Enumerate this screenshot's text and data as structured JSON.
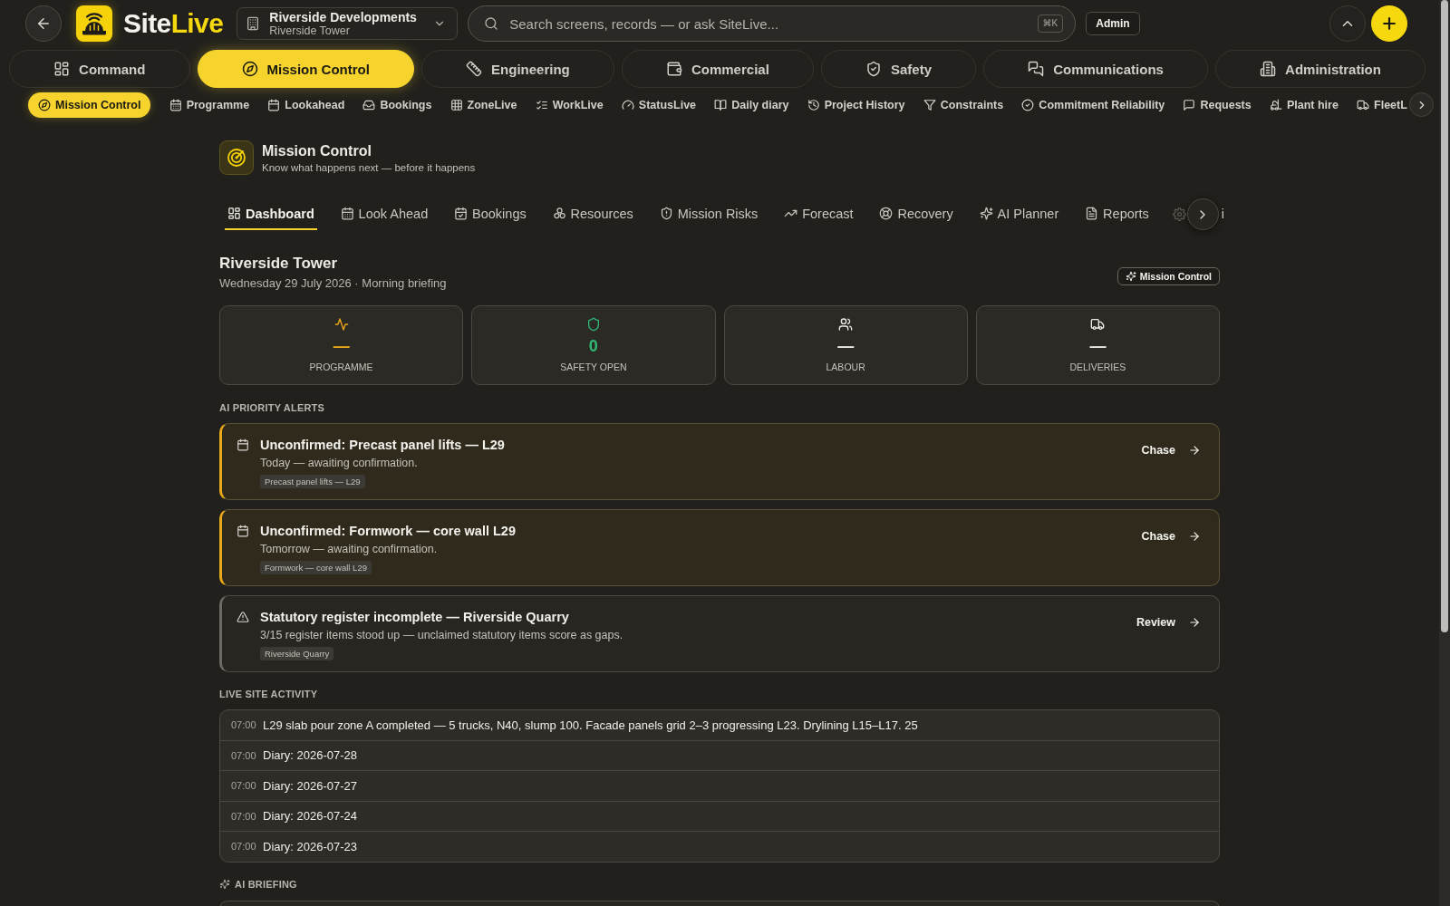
{
  "top_bar": {
    "brand": {
      "name_start": "Site",
      "name_end": "Live"
    },
    "project_selector": {
      "company": "Riverside Developments",
      "project": "Riverside Tower"
    },
    "search": {
      "placeholder": "Search screens, records — or ask SiteLive...",
      "shortcut": "⌘K"
    },
    "role": "Admin"
  },
  "module_tabs": [
    {
      "label": "Command",
      "selected": false
    },
    {
      "label": "Mission Control",
      "selected": true
    },
    {
      "label": "Engineering",
      "selected": false
    },
    {
      "label": "Commercial",
      "selected": false
    },
    {
      "label": "Safety",
      "selected": false
    },
    {
      "label": "Communications",
      "selected": false
    },
    {
      "label": "Administration",
      "selected": false
    }
  ],
  "sub_nav": [
    {
      "label": "Mission Control",
      "selected": true
    },
    {
      "label": "Programme",
      "selected": false
    },
    {
      "label": "Lookahead",
      "selected": false
    },
    {
      "label": "Bookings",
      "selected": false
    },
    {
      "label": "ZoneLive",
      "selected": false
    },
    {
      "label": "WorkLive",
      "selected": false
    },
    {
      "label": "StatusLive",
      "selected": false
    },
    {
      "label": "Daily diary",
      "selected": false
    },
    {
      "label": "Project History",
      "selected": false
    },
    {
      "label": "Constraints",
      "selected": false
    },
    {
      "label": "Commitment Reliability",
      "selected": false
    },
    {
      "label": "Requests",
      "selected": false
    },
    {
      "label": "Plant hire",
      "selected": false
    },
    {
      "label": "FleetL",
      "selected": false
    }
  ],
  "page_header": {
    "title": "Mission Control",
    "subtitle": "Know what happens next — before it happens"
  },
  "page_tabs": [
    {
      "label": "Dashboard",
      "selected": true
    },
    {
      "label": "Look Ahead",
      "selected": false
    },
    {
      "label": "Bookings",
      "selected": false
    },
    {
      "label": "Resources",
      "selected": false
    },
    {
      "label": "Mission Risks",
      "selected": false
    },
    {
      "label": "Forecast",
      "selected": false
    },
    {
      "label": "Recovery",
      "selected": false
    },
    {
      "label": "AI Planner",
      "selected": false
    },
    {
      "label": "Reports",
      "selected": false
    },
    {
      "label": "i",
      "selected": false
    }
  ],
  "site": {
    "name": "Riverside Tower",
    "date_line": "Wednesday 29 July 2026 · Morning briefing",
    "badge": "Mission Control"
  },
  "kpis": [
    {
      "value": "—",
      "label": "PROGRAMME",
      "color": "#eea71a"
    },
    {
      "value": "0",
      "label": "SAFETY OPEN",
      "color": "#2fb874"
    },
    {
      "value": "—",
      "label": "LABOUR",
      "color": "#ecebe6"
    },
    {
      "value": "—",
      "label": "DELIVERIES",
      "color": "#ecebe6"
    }
  ],
  "alerts_section": {
    "heading": "AI PRIORITY ALERTS",
    "alerts": [
      {
        "kind": "booking",
        "title": "Unconfirmed: Precast panel lifts — L29",
        "description": "Today — awaiting confirmation.",
        "tag": "Precast panel lifts — L29",
        "action": "Chase"
      },
      {
        "kind": "booking",
        "title": "Unconfirmed: Formwork — core wall L29",
        "description": "Tomorrow — awaiting confirmation.",
        "tag": "Formwork — core wall L29",
        "action": "Chase"
      },
      {
        "kind": "compliance",
        "title": "Statutory register incomplete — Riverside Quarry",
        "description": "3/15 register items stood up — unclaimed statutory items score as gaps.",
        "tag": "Riverside Quarry",
        "action": "Review"
      }
    ]
  },
  "activity_section": {
    "heading": "LIVE SITE ACTIVITY",
    "rows": [
      {
        "time": "07:00",
        "text": "L29 slab pour zone A completed — 5 trucks, N40, slump 100. Facade panels grid 2–3 progressing L23. Drylining L15–L17. 25"
      },
      {
        "time": "07:00",
        "text": "Diary: 2026-07-28"
      },
      {
        "time": "07:00",
        "text": "Diary: 2026-07-27"
      },
      {
        "time": "07:00",
        "text": "Diary: 2026-07-24"
      },
      {
        "time": "07:00",
        "text": "Diary: 2026-07-23"
      }
    ]
  },
  "briefing_section": {
    "heading": "AI BRIEFING"
  }
}
